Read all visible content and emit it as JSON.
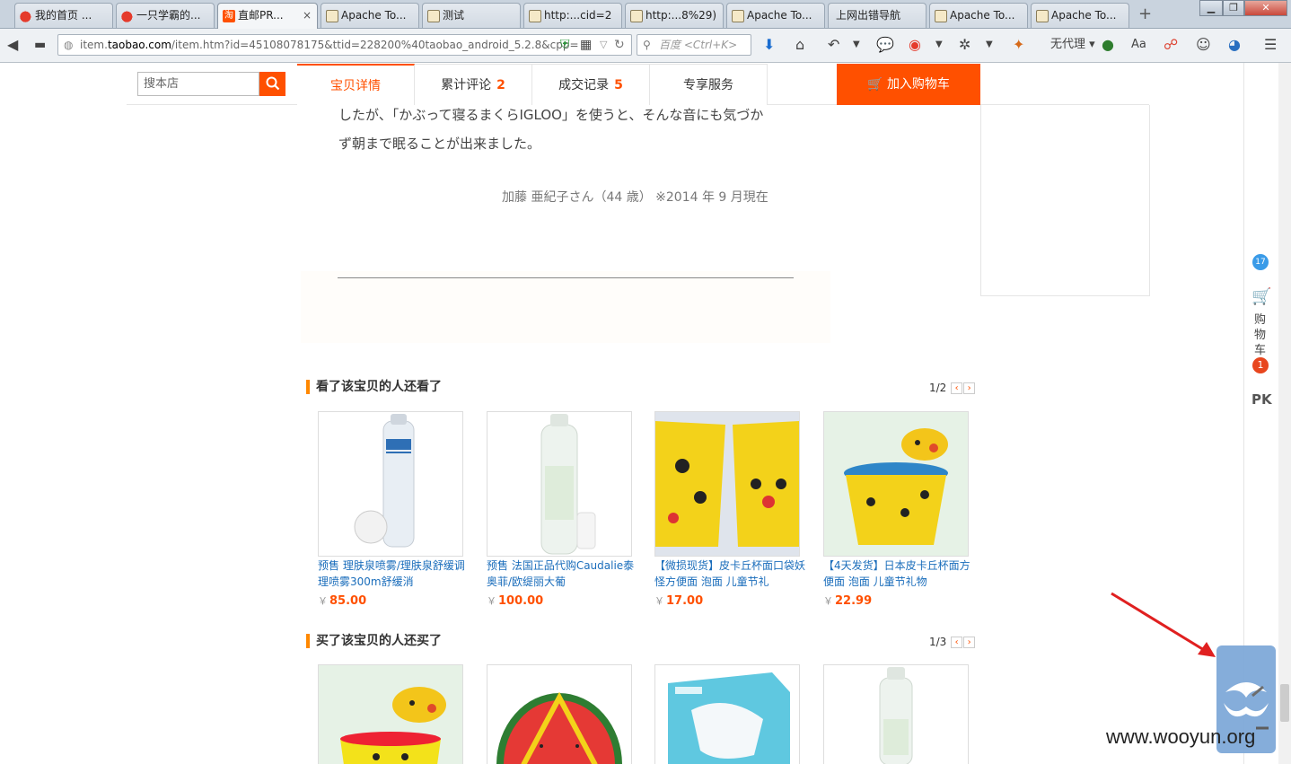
{
  "tabs": [
    {
      "label": "我的首页 ...",
      "icon": "weibo-icon"
    },
    {
      "label": "一只学霸的...",
      "icon": "weibo-icon"
    },
    {
      "label": "直邮PR...",
      "icon": "taobao-icon",
      "active": true
    },
    {
      "label": "Apache To...",
      "icon": "apache-icon"
    },
    {
      "label": "测试",
      "icon": "apache-icon"
    },
    {
      "label": "http:...cid=2",
      "icon": "apache-icon"
    },
    {
      "label": "http:...8%29)",
      "icon": "apache-icon"
    },
    {
      "label": "Apache To...",
      "icon": "apache-icon"
    },
    {
      "label": "上网出错导航",
      "icon": ""
    },
    {
      "label": "Apache To...",
      "icon": "apache-icon"
    },
    {
      "label": "Apache To...",
      "icon": "apache-icon"
    }
  ],
  "browser": {
    "url_prefix": "item.",
    "url_domain": "taobao.com",
    "url_rest": "/item.htm?id=45108078175&ttid=228200%40taobao_android_5.2.8&cpp=",
    "search_placeholder": "百度 <Ctrl+K>",
    "proxy_label": "无代理"
  },
  "shop": {
    "search_placeholder": "搜本店",
    "tabs": [
      {
        "label": "宝贝详情",
        "count": ""
      },
      {
        "label": "累计评论",
        "count": "2"
      },
      {
        "label": "成交记录",
        "count": "5"
      },
      {
        "label": "专享服务",
        "count": ""
      }
    ],
    "add_to_cart": "加入购物车"
  },
  "detail": {
    "line1": "したが、「かぶって寝るまくらIGLOO」を使うと、そんな音にも気づか",
    "line2": "ず朝まで眠ることが出来ました。",
    "author": "加藤 亜紀子さん（44 歳） ※2014 年 9 月現在"
  },
  "section_viewed": {
    "title": "看了该宝贝的人还看了",
    "pager": "1/2",
    "items": [
      {
        "title": "预售 理肤泉喷雾/理肤泉舒缓调理喷雾300m舒缓消",
        "price": "85.00"
      },
      {
        "title": "预售 法国正品代购Caudalie泰奥菲/欧缇丽大葡",
        "price": "100.00"
      },
      {
        "title": "【微损现货】皮卡丘杯面口袋妖怪方便面 泡面 儿童节礼",
        "price": "17.00"
      },
      {
        "title": "【4天发货】日本皮卡丘杯面方便面 泡面 儿童节礼物",
        "price": "22.99"
      }
    ]
  },
  "section_bought": {
    "title": "买了该宝贝的人还买了",
    "pager": "1/3"
  },
  "sidebar": {
    "badge_top": "17",
    "cart_label_chars": [
      "购",
      "物",
      "车"
    ],
    "cart_count": "1",
    "pk_label": "PK"
  },
  "currency": "￥",
  "watermark": "www.wooyun.org",
  "colors": {
    "accent": "#ff5000",
    "link": "#1a6dbb",
    "section_bar": "#ff8800"
  }
}
